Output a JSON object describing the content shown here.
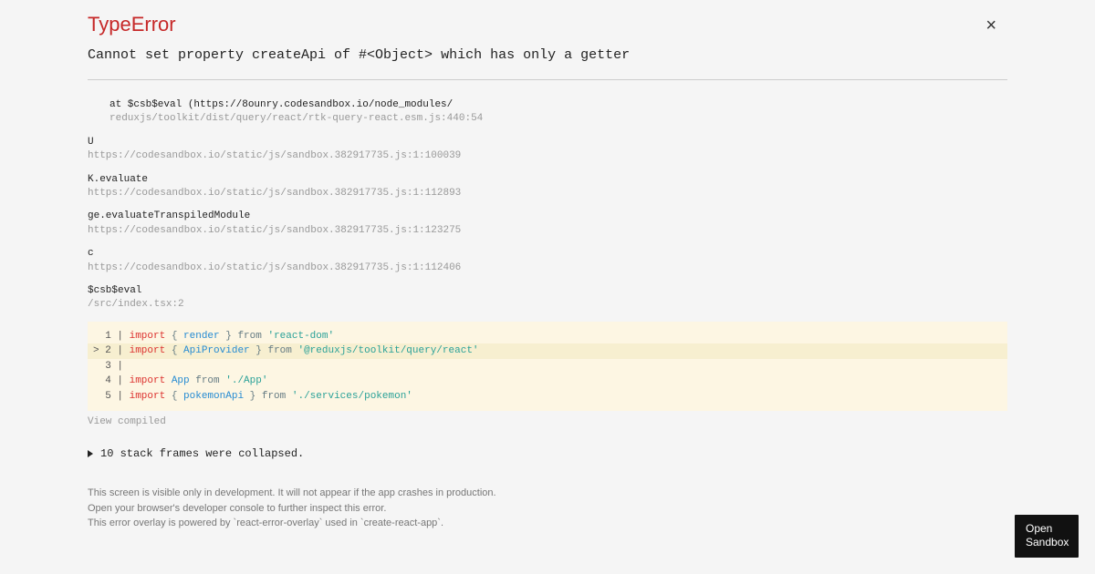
{
  "error": {
    "title": "TypeError",
    "message": "Cannot set property createApi of #<Object> which has only a getter"
  },
  "close_label": "×",
  "stack": [
    {
      "name": "   at $csb$eval (https://8ounry.codesandbox.io/node_modules/",
      "source": "reduxjs/toolkit/dist/query/react/rtk-query-react.esm.js:440:54"
    },
    {
      "name": "U",
      "source": "https://codesandbox.io/static/js/sandbox.382917735.js:1:100039"
    },
    {
      "name": "K.evaluate",
      "source": "https://codesandbox.io/static/js/sandbox.382917735.js:1:112893"
    },
    {
      "name": "ge.evaluateTranspiledModule",
      "source": "https://codesandbox.io/static/js/sandbox.382917735.js:1:123275"
    },
    {
      "name": "c",
      "source": "https://codesandbox.io/static/js/sandbox.382917735.js:1:112406"
    },
    {
      "name": "$csb$eval",
      "source": "/src/index.tsx:2"
    }
  ],
  "code": {
    "line1_gutter": "  1 | ",
    "line2_gutter": "> 2 | ",
    "line3_gutter": "  3 | ",
    "line4_gutter": "  4 | ",
    "line5_gutter": "  5 | ",
    "import_kw": "import",
    "from_kw": "from",
    "l1_brace_open": " { ",
    "l1_ident": "render",
    "l1_brace_close": " } ",
    "l1_pkg": "'react-dom'",
    "l2_brace_open": " { ",
    "l2_ident": "ApiProvider",
    "l2_brace_close": " } ",
    "l2_pkg": "'@reduxjs/toolkit/query/react'",
    "l4_ident": " App ",
    "l4_pkg": "'./App'",
    "l5_brace_open": " { ",
    "l5_ident": "pokemonApi",
    "l5_brace_close": " } ",
    "l5_pkg": "'./services/pokemon'"
  },
  "view_compiled": "View compiled",
  "collapsed_frames": "10 stack frames were collapsed.",
  "footer": {
    "line1": "This screen is visible only in development. It will not appear if the app crashes in production.",
    "line2": "Open your browser's developer console to further inspect this error.",
    "line3": "This error overlay is powered by `react-error-overlay` used in `create-react-app`."
  },
  "open_sandbox": "Open Sandbox"
}
